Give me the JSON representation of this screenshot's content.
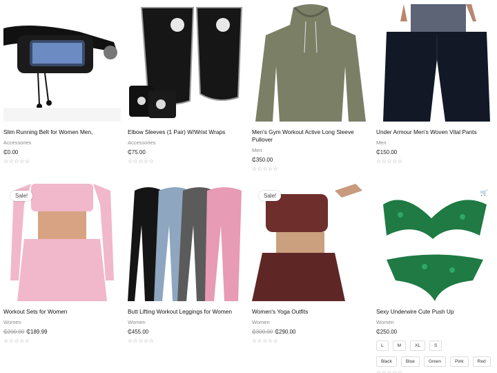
{
  "products": [
    {
      "title": "Slim Running Belt for Women Men,",
      "category": "Accessories",
      "price": "₵0.00",
      "stars": "☆☆☆☆☆"
    },
    {
      "title": "Elbow Sleeves (1 Pair) W/Wrist Wraps",
      "category": "Accessories",
      "price": "₵75.00",
      "stars": "☆☆☆☆☆"
    },
    {
      "title": "Men's Gym Workout Active Long Sleeve Pullover",
      "category": "Men",
      "price": "₵350.00",
      "stars": "☆☆☆☆☆"
    },
    {
      "title": "Under Armour Men's Woven Vital Pants",
      "category": "Men",
      "price": "₵150.00",
      "stars": "☆☆☆☆☆"
    },
    {
      "title": "Workout Sets for Women",
      "category": "Women",
      "old_price": "₵200.00",
      "price": "₵189.99",
      "badge": "Sale!",
      "stars": "☆☆☆☆☆"
    },
    {
      "title": "Butt Lifting Workout Leggings for Women",
      "category": "Women",
      "price": "₵455.00",
      "stars": "☆☆☆☆☆"
    },
    {
      "title": "Women's Yoga Outfits",
      "category": "Women",
      "old_price": "₵300.00",
      "price": "₵290.00",
      "badge": "Sale!",
      "stars": "☆☆☆☆☆"
    },
    {
      "title": "Sexy Underwire Cute Push Up",
      "category": "Women",
      "price": "₵250.00",
      "stars": "☆☆☆☆☆",
      "sizes": [
        "L",
        "M",
        "XL",
        "S"
      ],
      "colors": [
        "Black",
        "Blue",
        "Green",
        "Pink",
        "Red"
      ]
    }
  ],
  "icons": {
    "cart": "cart-icon",
    "star": "star-outline-icon"
  }
}
